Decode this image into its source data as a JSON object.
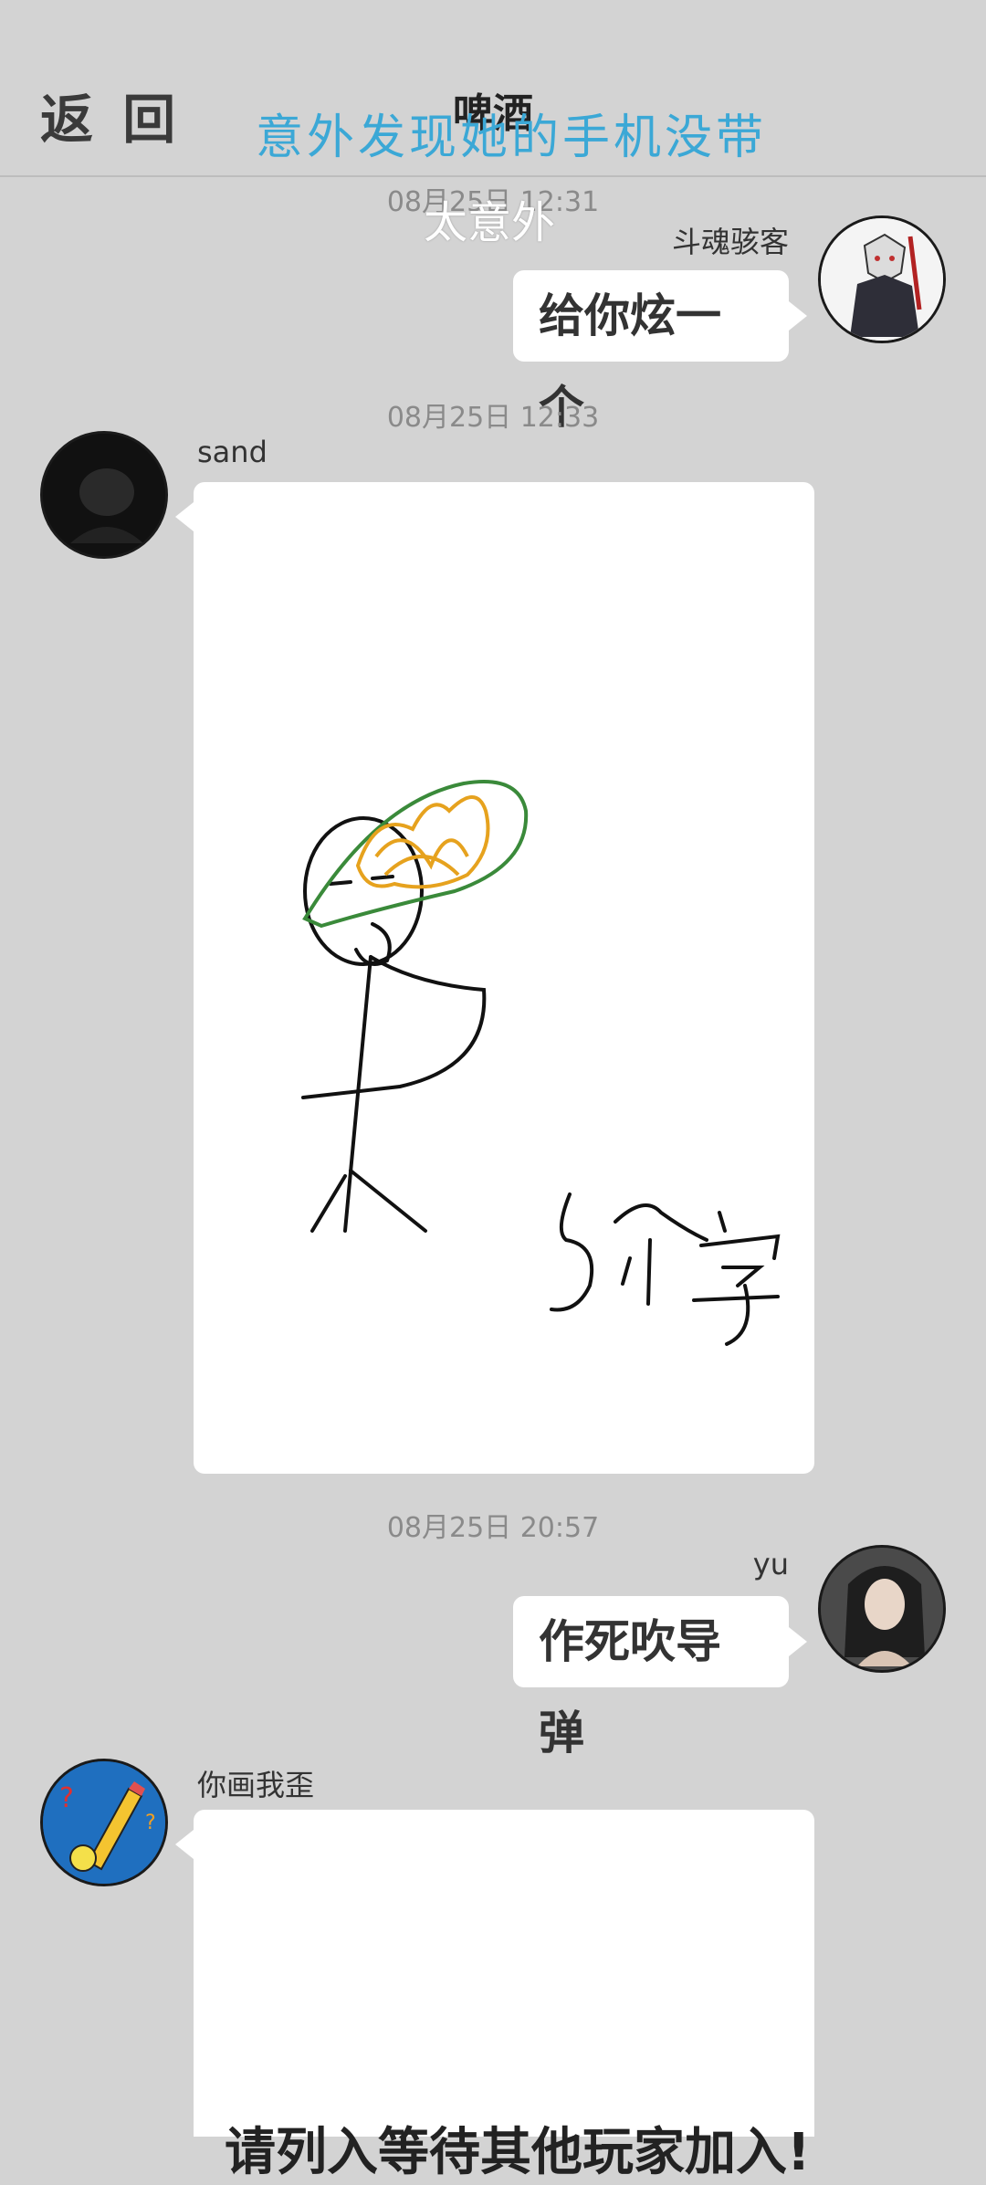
{
  "header": {
    "back_label": "返 回",
    "title": "啤酒",
    "overlay_caption": "意外发现她的手机没带",
    "overlay_sub": "太意外"
  },
  "messages": [
    {
      "time": "08月25日  12:31",
      "sender": "斗魂骇客",
      "text": "给你炫一个",
      "side": "right"
    },
    {
      "time": "08月25日  12:33",
      "sender": "sand",
      "type": "drawing",
      "side": "left",
      "drawing_text": "5个字"
    },
    {
      "time": "08月25日  20:57",
      "sender": "yu",
      "text": "作死吹导弹",
      "side": "right"
    },
    {
      "sender": "你画我歪",
      "type": "card",
      "side": "left",
      "partial_text": "请列入等待其他玩家加入!"
    }
  ],
  "colors": {
    "background": "#d3d3d3",
    "bubble": "#ffffff",
    "overlay_caption": "#3ba8d6"
  }
}
